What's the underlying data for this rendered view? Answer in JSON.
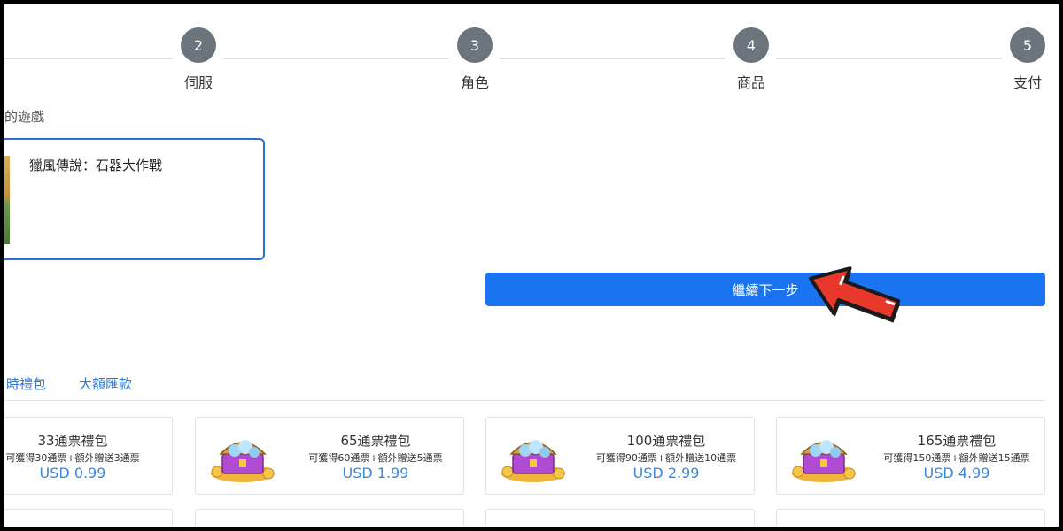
{
  "stepper": {
    "steps": [
      {
        "number": "2",
        "label": "伺服"
      },
      {
        "number": "3",
        "label": "角色"
      },
      {
        "number": "4",
        "label": "商品"
      },
      {
        "number": "5",
        "label": "支付"
      }
    ]
  },
  "game_section": {
    "label": "的遊戲",
    "selected_game": "獵風傳說：石器大作戰"
  },
  "next_button": {
    "label": "繼續下一步"
  },
  "tabs": [
    {
      "label": "時禮包"
    },
    {
      "label": "大額匯款"
    }
  ],
  "products": [
    {
      "name": "33通票禮包",
      "desc": "可獲得30通票+額外贈送3通票",
      "price": "USD 0.99"
    },
    {
      "name": "65通票禮包",
      "desc": "可獲得60通票+額外贈送5通票",
      "price": "USD 1.99"
    },
    {
      "name": "100通票禮包",
      "desc": "可獲得90通票+額外贈送10通票",
      "price": "USD 2.99"
    },
    {
      "name": "165通票禮包",
      "desc": "可獲得150通票+額外贈送15通票",
      "price": "USD 4.99"
    }
  ],
  "colors": {
    "accent": "#1a73f0",
    "step_circle": "#6c757d",
    "price": "#3b86d8",
    "card_border_selected": "#2a6fd6",
    "annotation_arrow": "#e8382b"
  },
  "icons": {
    "product": "treasure-chest-icon",
    "annotation": "red-pointer-arrow"
  }
}
